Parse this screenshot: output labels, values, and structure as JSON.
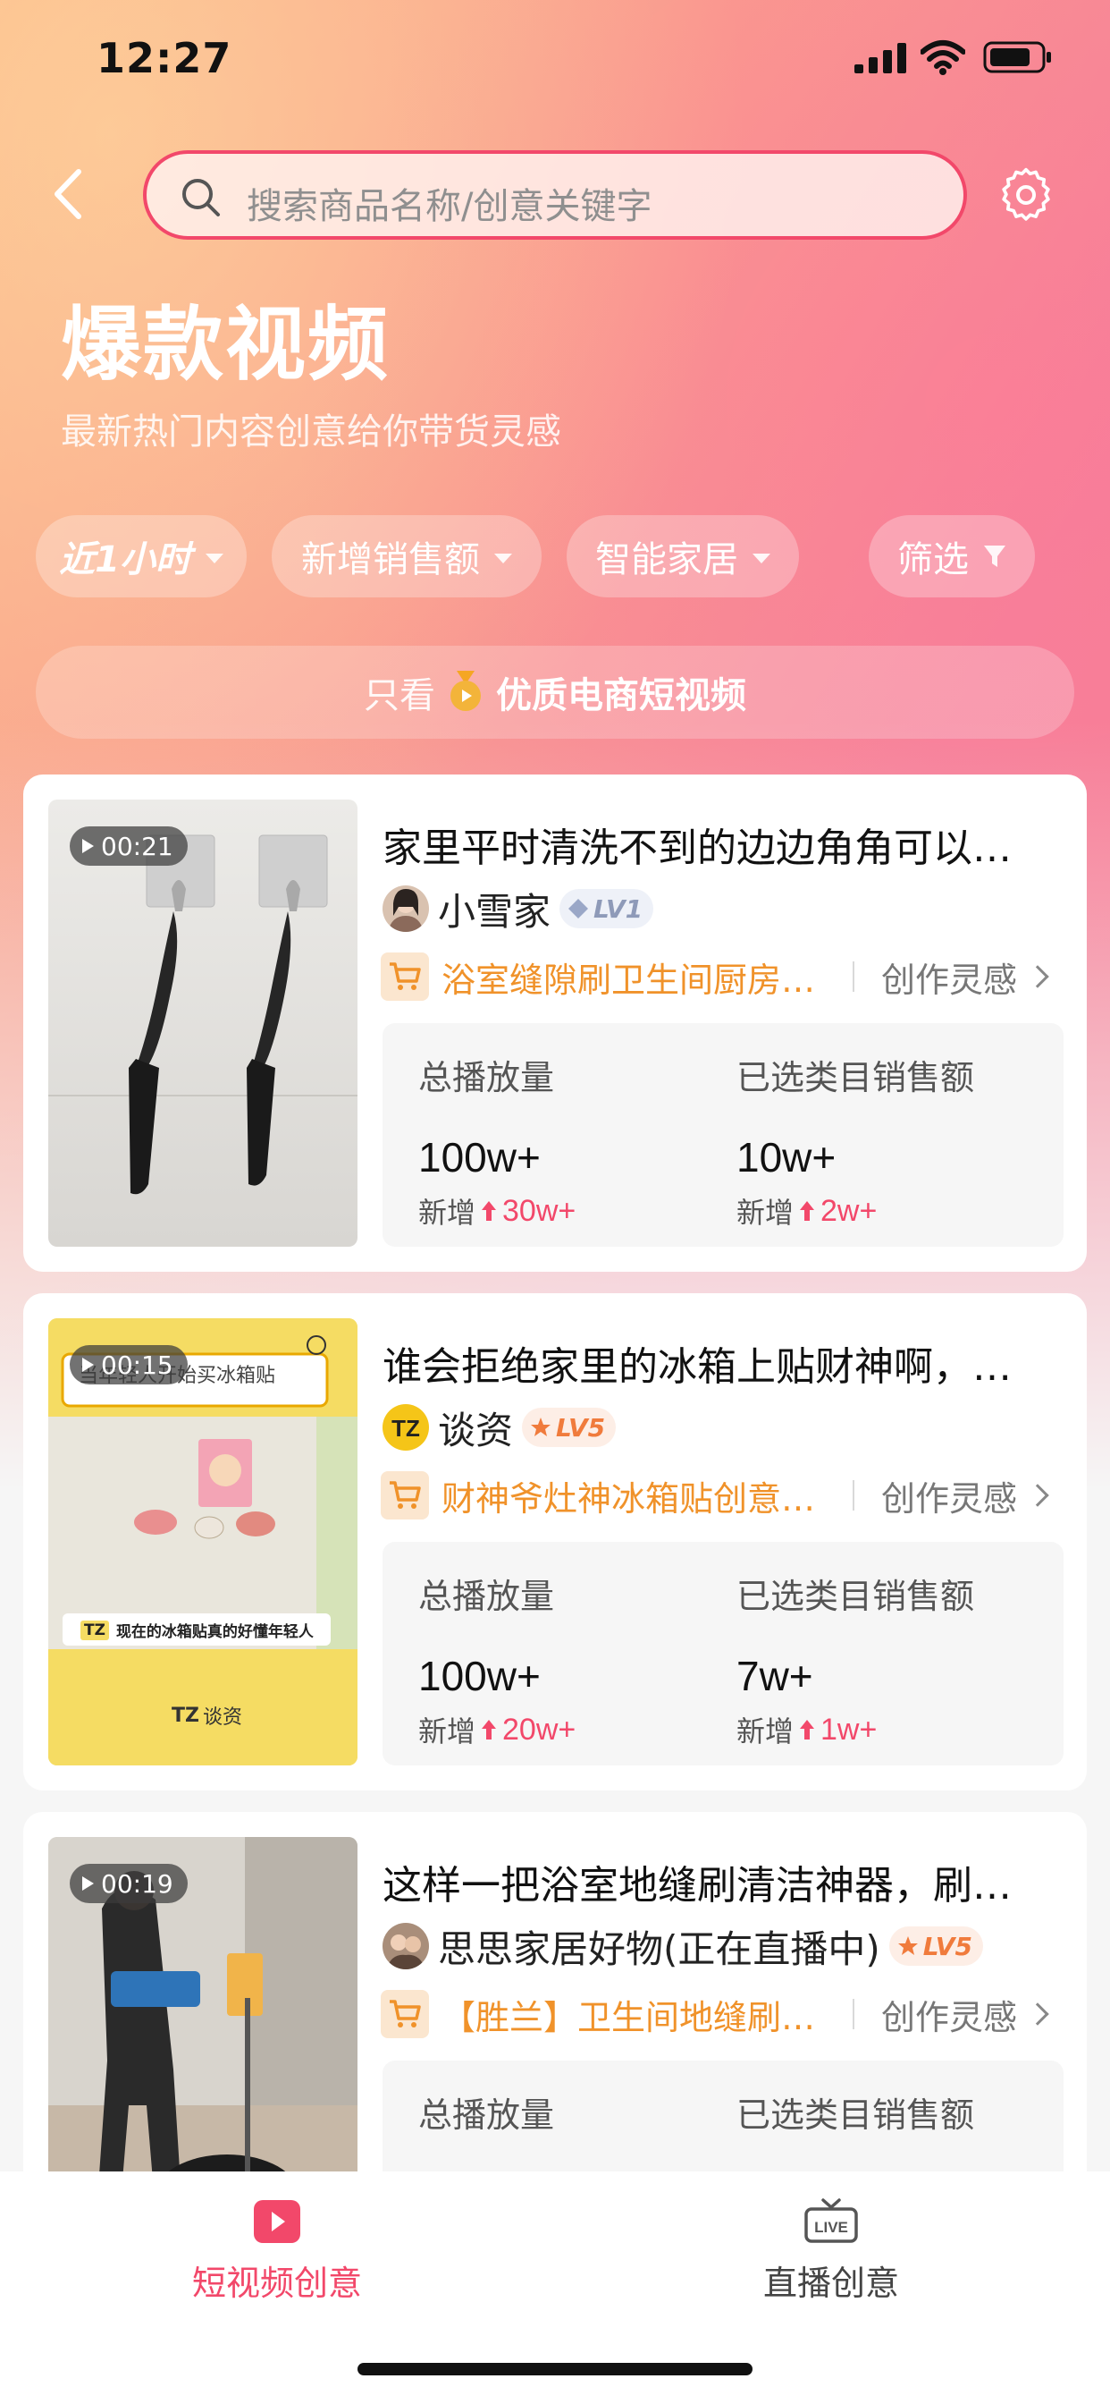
{
  "status_bar": {
    "time": "12:27"
  },
  "header": {
    "search_placeholder": "搜索商品名称/创意关键字",
    "title": "爆款视频",
    "subtitle": "最新热门内容创意给你带货灵感"
  },
  "filters": {
    "time": "近1小时",
    "sort": "新增销售额",
    "category": "智能家居",
    "filter": "筛选"
  },
  "quality_bar": {
    "prefix": "只看",
    "label": "优质电商短视频"
  },
  "cards": [
    {
      "duration": "00:21",
      "title": "家里平时清洗不到的边边角角可以…",
      "author": "小雪家",
      "level": "LV1",
      "product": "浴室缝隙刷卫生间厨房…",
      "inspire": "创作灵感",
      "plays_label": "总播放量",
      "plays_value": "100w+",
      "plays_delta_label": "新增",
      "plays_delta": "30w+",
      "sales_label": "已选类目销售额",
      "sales_value": "10w+",
      "sales_delta_label": "新增",
      "sales_delta": "2w+"
    },
    {
      "duration": "00:15",
      "title": "谁会拒绝家里的冰箱上贴财神啊，…",
      "author": "谈资",
      "level": "LV5",
      "product": "财神爷灶神冰箱贴创意…",
      "inspire": "创作灵感",
      "plays_label": "总播放量",
      "plays_value": "100w+",
      "plays_delta_label": "新增",
      "plays_delta": "20w+",
      "sales_label": "已选类目销售额",
      "sales_value": "7w+",
      "sales_delta_label": "新增",
      "sales_delta": "1w+",
      "thumb_banner": "当年轻人开始买冰箱贴",
      "thumb_caption": "现在的冰箱贴真的好懂年轻人",
      "thumb_logo": "TZ",
      "thumb_brand": "谈资"
    },
    {
      "duration": "00:19",
      "title": "这样一把浴室地缝刷清洁神器，刷…",
      "author": "思思家居好物(正在直播中)",
      "level": "LV5",
      "product": "【胜兰】卫生间地缝刷…",
      "inspire": "创作灵感",
      "plays_label": "总播放量",
      "sales_label": "已选类目销售额"
    }
  ],
  "bottom_nav": {
    "short_video": "短视频创意",
    "live": "直播创意",
    "live_icon_text": "LIVE"
  },
  "colors": {
    "accent": "#f2486a",
    "product_orange": "#f0922a"
  }
}
